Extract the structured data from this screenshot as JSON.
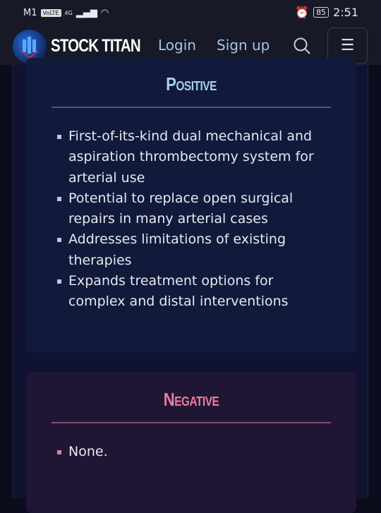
{
  "status_bar": {
    "carrier": "M1",
    "volte": "VoLTE",
    "network": "4G",
    "battery": "85",
    "time": "2:51"
  },
  "nav": {
    "brand": "STOCK TITAN",
    "login": "Login",
    "signup": "Sign up",
    "menu_icon": "hamburger-icon",
    "search_icon": "search-icon"
  },
  "positive": {
    "title": "Positive",
    "color": "#a9cdf0",
    "items": [
      "First-of-its-kind dual mechanical and aspiration thrombectomy system for arterial use",
      "Potential to replace open surgical repairs in many arterial cases",
      "Addresses limitations of existing therapies",
      "Expands treatment options for complex and distal interventions"
    ]
  },
  "negative": {
    "title": "Negative",
    "color": "#f07b9c",
    "items": [
      "None."
    ]
  }
}
